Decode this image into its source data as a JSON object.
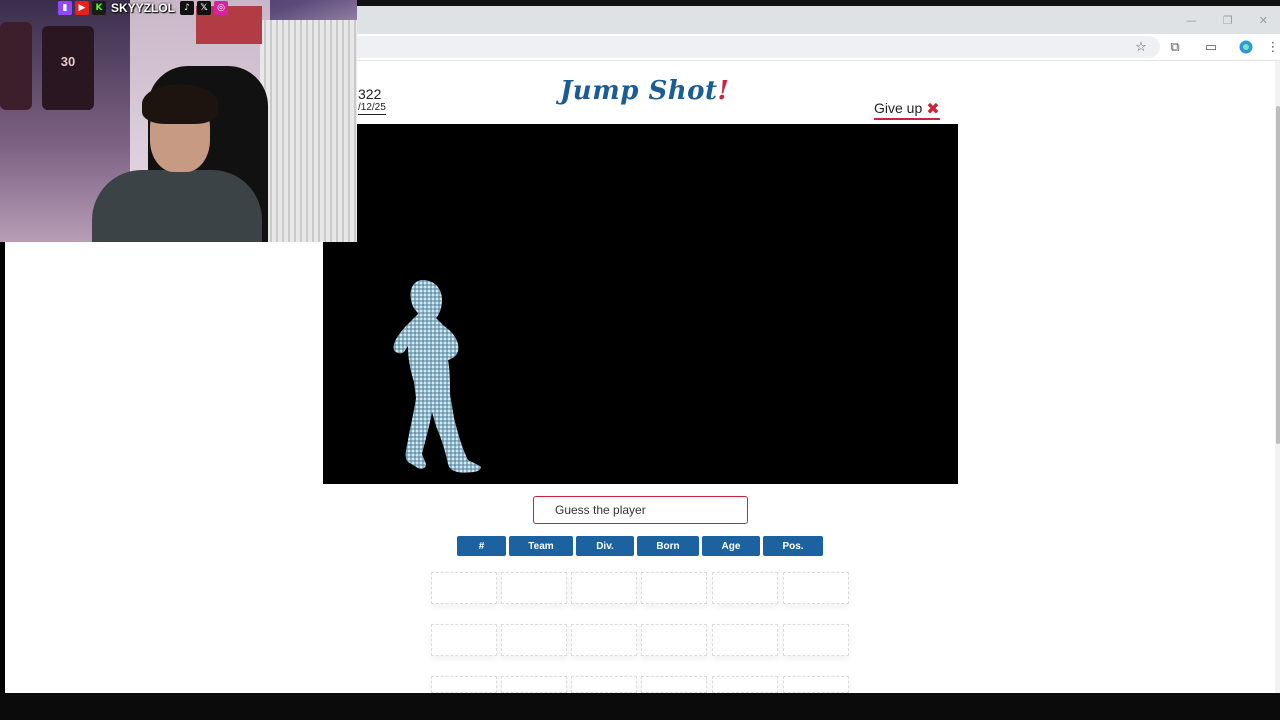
{
  "browser": {
    "window_controls": {
      "minimize": "—",
      "restore": "❐",
      "close": "✕"
    },
    "toolbar_icons": {
      "bookmark": "star-icon",
      "extensions": "puzzle-icon",
      "cast": "cast-icon",
      "profile": "profile-icon",
      "menu": "kebab-menu-icon"
    }
  },
  "game": {
    "number": "322",
    "date": "/12/25",
    "logo_main": "Jump Shot",
    "logo_accent": "!",
    "give_up_label": "Give up",
    "give_up_icon": "✖",
    "input_placeholder": "Guess the player",
    "columns": [
      "#",
      "Team",
      "Div.",
      "Born",
      "Age",
      "Pos."
    ],
    "guess_rows": 3
  },
  "webcam": {
    "handle": "SKYYZLOL",
    "jersey_number": "30",
    "social_icons": [
      "twitch-icon",
      "youtube-icon",
      "kick-icon",
      "tiktok-icon",
      "x-icon",
      "instagram-icon"
    ]
  },
  "colors": {
    "brand_blue": "#1d62a0",
    "accent_red": "#c8243a"
  }
}
